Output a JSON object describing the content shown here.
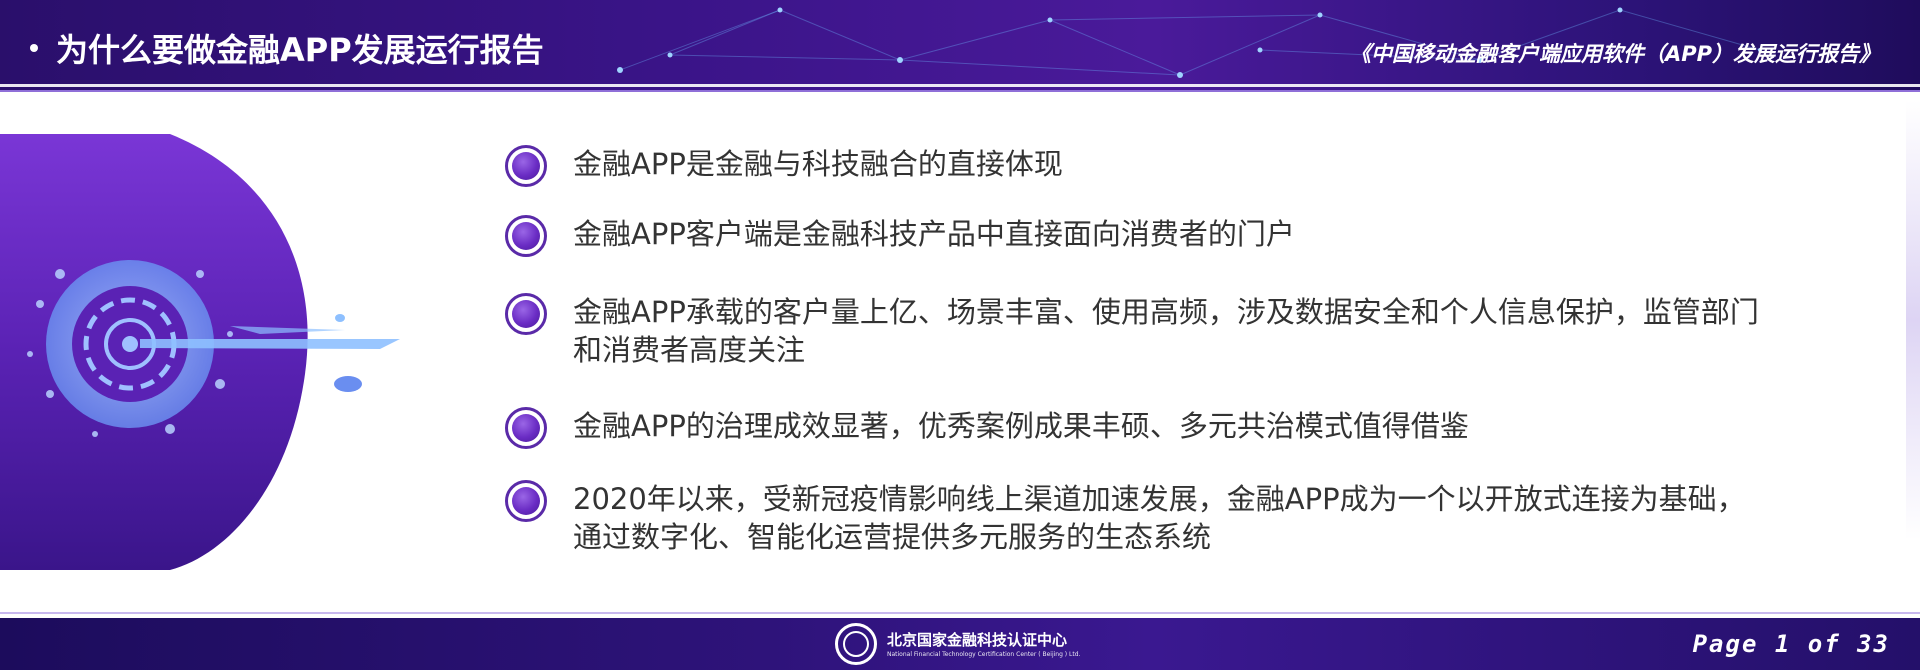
{
  "header": {
    "title": "为什么要做金融APP发展运行报告",
    "report_name": "《中国移动金融客户端应用软件（APP）发展运行报告》"
  },
  "bullets": [
    {
      "lines": [
        "金融APP是金融与科技融合的直接体现"
      ]
    },
    {
      "lines": [
        "金融APP客户端是金融科技产品中直接面向消费者的门户"
      ]
    },
    {
      "lines": [
        "金融APP承载的客户量上亿、场景丰富、使用高频，涉及数据安全和个人信息保护，监管部门",
        "和消费者高度关注"
      ]
    },
    {
      "lines": [
        "金融APP的治理成效显著，优秀案例成果丰硕、多元共治模式值得借鉴"
      ]
    },
    {
      "lines": [
        "2020年以来，受新冠疫情影响线上渠道加速发展，金融APP成为一个以开放式连接为基础，",
        "通过数字化、智能化运营提供多元服务的生态系统"
      ]
    }
  ],
  "footer": {
    "org_cn": "北京国家金融科技认证中心",
    "org_en": "National Financial Technology Certification Center ( Beijing ) Ltd.",
    "page_label": "Page 1 of 33"
  },
  "colors": {
    "header_bg": "#3a1488",
    "accent": "#5a2aa8",
    "text": "#333333"
  }
}
